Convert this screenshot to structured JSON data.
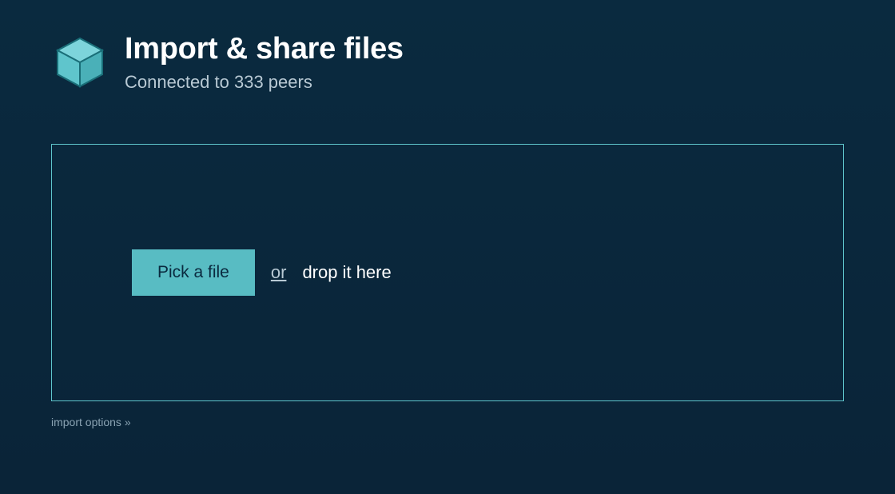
{
  "header": {
    "title": "Import & share files",
    "subtitle": "Connected to 333 peers"
  },
  "dropzone": {
    "pick_button_label": "Pick a file",
    "or_text": "or",
    "drop_text": "drop it here"
  },
  "footer": {
    "import_options_link": "import options »"
  },
  "icons": {
    "cube": "cube-icon"
  },
  "colors": {
    "background_top": "#0a2a3f",
    "background_bottom": "#0a2438",
    "accent": "#5fc5cc",
    "button_bg": "#58bcc3",
    "text_primary": "#ffffff",
    "text_secondary": "#b8c9d4",
    "text_muted": "#8aa3b3"
  }
}
